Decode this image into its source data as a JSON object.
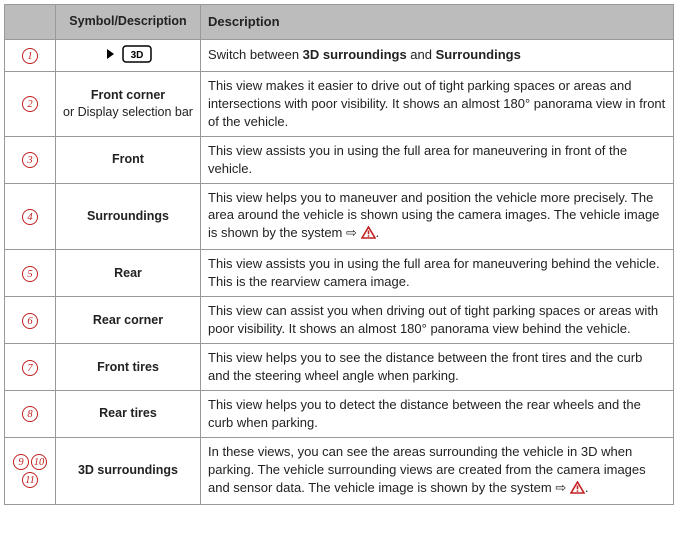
{
  "header": {
    "col1": "",
    "col2": "Symbol/Descrip­tion",
    "col3": "Description"
  },
  "rows": [
    {
      "nums": [
        "1"
      ],
      "symbol_kind": "icon3d",
      "symbol_main": "",
      "symbol_sub": "",
      "desc_parts": [
        {
          "t": "Switch between ",
          "b": false
        },
        {
          "t": "3D surroundings",
          "b": true
        },
        {
          "t": " and ",
          "b": false
        },
        {
          "t": "Surroundings",
          "b": true
        }
      ],
      "has_warn": false
    },
    {
      "nums": [
        "2"
      ],
      "symbol_kind": "text",
      "symbol_main": "Front corner",
      "symbol_sub": "or Display selection bar",
      "desc_parts": [
        {
          "t": "This view makes it easier to drive out of tight parking spaces or areas and intersections with poor visibility. It shows an almost 180° panorama view in front of the vehicle.",
          "b": false
        }
      ],
      "has_warn": false
    },
    {
      "nums": [
        "3"
      ],
      "symbol_kind": "text",
      "symbol_main": "Front",
      "symbol_sub": "",
      "desc_parts": [
        {
          "t": "This view assists you in using the full area for maneuvering in front of the vehicle.",
          "b": false
        }
      ],
      "has_warn": false
    },
    {
      "nums": [
        "4"
      ],
      "symbol_kind": "text",
      "symbol_main": "Surroundings",
      "symbol_sub": "",
      "desc_parts": [
        {
          "t": "This view helps you to maneuver and position the vehicle more precisely. The area around the vehicle is shown using the camera images. The vehicle image is shown by the system ",
          "b": false
        }
      ],
      "has_warn": true
    },
    {
      "nums": [
        "5"
      ],
      "symbol_kind": "text",
      "symbol_main": "Rear",
      "symbol_sub": "",
      "desc_parts": [
        {
          "t": "This view assists you in using the full area for maneuvering behind the ve­hicle. This is the rearview camera image.",
          "b": false
        }
      ],
      "has_warn": false
    },
    {
      "nums": [
        "6"
      ],
      "symbol_kind": "text",
      "symbol_main": "Rear corner",
      "symbol_sub": "",
      "desc_parts": [
        {
          "t": "This view can assist you when driving out of tight parking spaces or areas with poor visibility. It shows an almost 180° panorama view behind the vehicle.",
          "b": false
        }
      ],
      "has_warn": false
    },
    {
      "nums": [
        "7"
      ],
      "symbol_kind": "text",
      "symbol_main": "Front tires",
      "symbol_sub": "",
      "desc_parts": [
        {
          "t": "This view helps you to see the distance between the front tires and the curb and the steering wheel angle when parking.",
          "b": false
        }
      ],
      "has_warn": false
    },
    {
      "nums": [
        "8"
      ],
      "symbol_kind": "text",
      "symbol_main": "Rear tires",
      "symbol_sub": "",
      "desc_parts": [
        {
          "t": "This view helps you to detect the distance between the rear wheels and the curb when parking.",
          "b": false
        }
      ],
      "has_warn": false
    },
    {
      "nums": [
        "9",
        "10",
        "11"
      ],
      "symbol_kind": "text",
      "symbol_main": "3D surroundings",
      "symbol_sub": "",
      "desc_parts": [
        {
          "t": "In these views, you can see the areas surrounding the vehicle in 3D when parking. The vehicle surrounding views are created from the camera im­ages and sensor data. The vehicle image is shown by the system ",
          "b": false
        }
      ],
      "has_warn": true
    }
  ],
  "icons": {
    "three_d_label": "3D",
    "arrow": "⇨"
  }
}
